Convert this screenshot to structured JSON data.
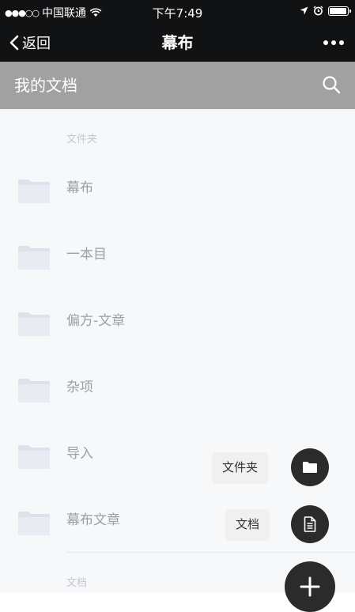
{
  "status_bar": {
    "signal_dots": "●●●○○",
    "carrier": "中国联通",
    "time": "下午7:49"
  },
  "nav": {
    "back_label": "返回",
    "title": "幕布"
  },
  "header": {
    "title": "我的文档"
  },
  "sections": {
    "folders_label": "文件夹",
    "documents_label": "文档"
  },
  "folders": [
    {
      "name": "幕布"
    },
    {
      "name": "一本目"
    },
    {
      "name": "偏方-文章"
    },
    {
      "name": "杂项"
    },
    {
      "name": "导入"
    },
    {
      "name": "幕布文章"
    }
  ],
  "fab_menu": {
    "folder_label": "文件夹",
    "document_label": "文档"
  },
  "colors": {
    "nav_bg": "#111214",
    "header_bg": "#a1a1a1",
    "fab_bg": "#2b2b2b"
  }
}
